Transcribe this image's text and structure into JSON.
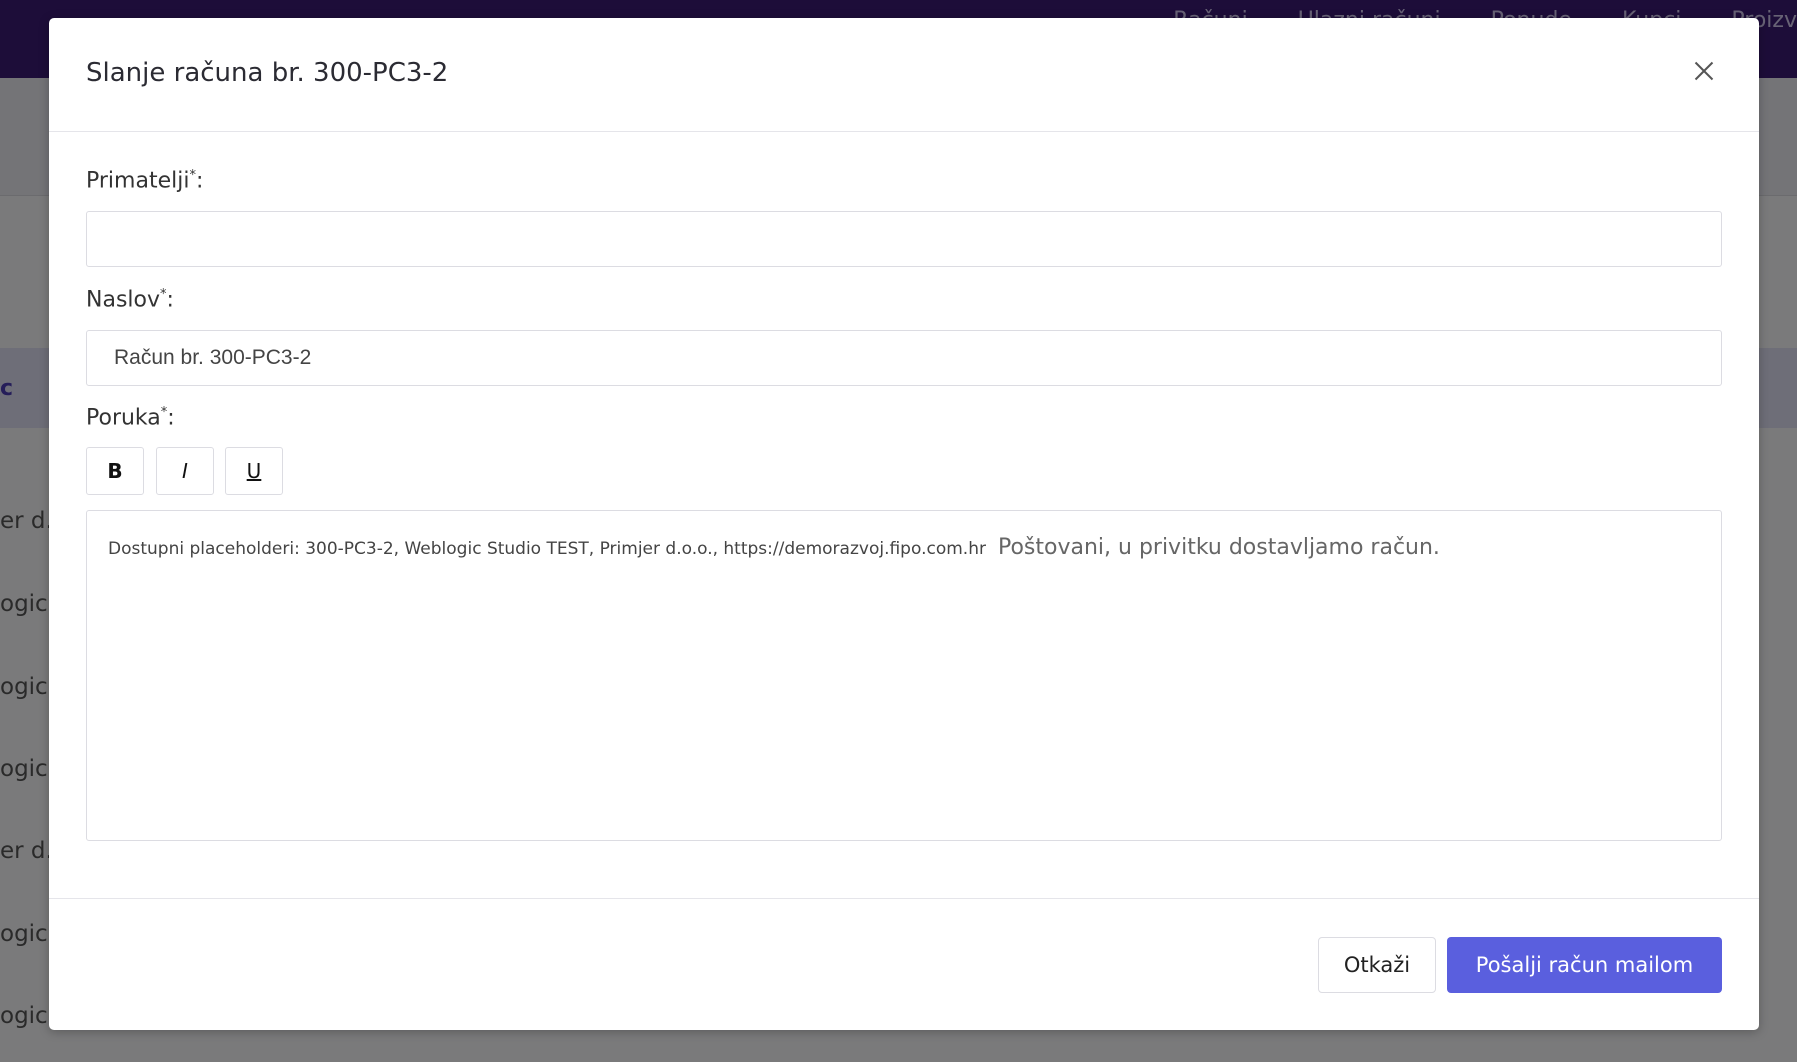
{
  "background": {
    "topnav": [
      "Računi",
      "Ulazni računi",
      "Ponude",
      "Kupci",
      "Proizv"
    ],
    "band_text": "c",
    "rows": [
      "er d.c",
      "ogic",
      "ogic",
      "ogic",
      "er d.c",
      "ogic",
      "ogic"
    ]
  },
  "modal": {
    "title": "Slanje računa br. 300-PC3-2",
    "recipients": {
      "label": "Primatelji",
      "required_mark": "*",
      "suffix": ":",
      "value": ""
    },
    "subject": {
      "label": "Naslov",
      "required_mark": "*",
      "suffix": ":",
      "value": "Račun br. 300-PC3-2"
    },
    "message": {
      "label": "Poruka",
      "required_mark": "*",
      "suffix": ":",
      "toolbar": {
        "bold": "B",
        "italic": "I",
        "underline": "U"
      },
      "placeholders_note": "Dostupni placeholderi: 300-PC3-2, Weblogic Studio TEST, Primjer d.o.o., https://demorazvoj.fipo.com.hr",
      "body": "Poštovani,   u privitku dostavljamo račun."
    },
    "buttons": {
      "cancel": "Otkaži",
      "send": "Pošalji račun mailom"
    }
  },
  "colors": {
    "topbar": "#3b1a73",
    "primary": "#5a5fde"
  }
}
